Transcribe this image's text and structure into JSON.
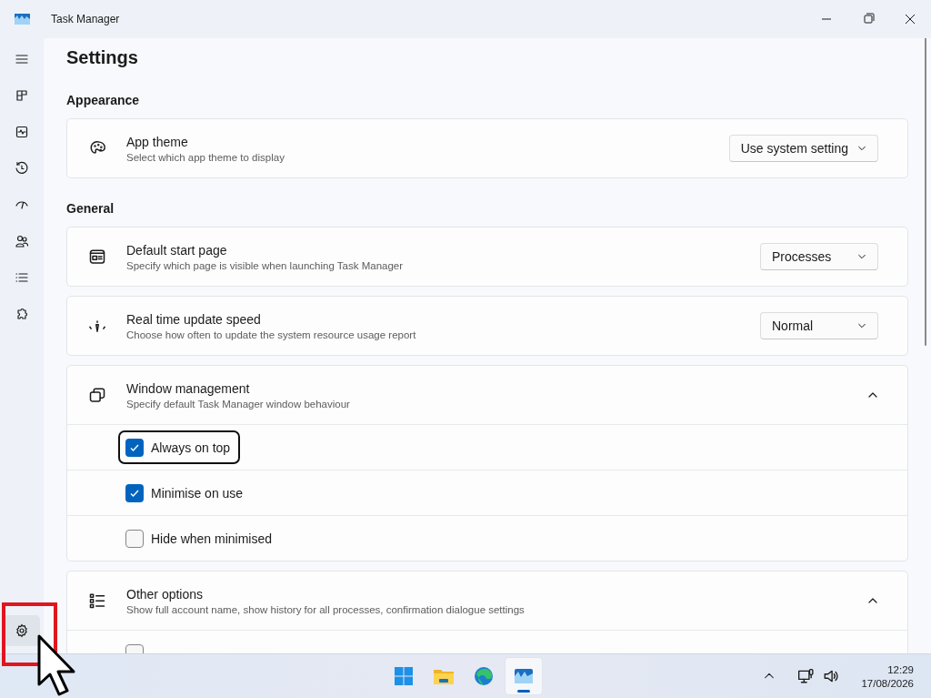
{
  "window": {
    "title": "Task Manager"
  },
  "sidebar": {
    "items": [
      {
        "selected": false
      },
      {
        "selected": false
      },
      {
        "selected": false
      },
      {
        "selected": false
      },
      {
        "selected": false
      },
      {
        "selected": false
      },
      {
        "selected": false
      },
      {
        "selected": false
      }
    ],
    "footer_item": {
      "selected": true
    }
  },
  "page": {
    "title": "Settings"
  },
  "sections": [
    {
      "heading": "Appearance",
      "cards": [
        {
          "kind": "dropdown",
          "title": "App theme",
          "description": "Select which app theme to display",
          "value": "Use system setting"
        }
      ]
    },
    {
      "heading": "General",
      "cards": [
        {
          "kind": "dropdown",
          "title": "Default start page",
          "description": "Specify which page is visible when launching Task Manager",
          "value": "Processes"
        },
        {
          "kind": "dropdown",
          "title": "Real time update speed",
          "description": "Choose how often to update the system resource usage report",
          "value": "Normal"
        },
        {
          "kind": "expander",
          "title": "Window management",
          "description": "Specify default Task Manager window behaviour",
          "expanded": true,
          "options": [
            {
              "label": "Always on top",
              "checked": true,
              "focused": true
            },
            {
              "label": "Minimise on use",
              "checked": true,
              "focused": false
            },
            {
              "label": "Hide when minimised",
              "checked": false,
              "focused": false
            }
          ]
        },
        {
          "kind": "expander",
          "title": "Other options",
          "description": "Show full account name, show history for all processes, confirmation dialogue settings",
          "expanded": true,
          "options": [
            {
              "checked": false,
              "focused": false
            }
          ]
        }
      ]
    }
  ],
  "taskbar": {
    "apps": [
      {
        "selected": false
      },
      {
        "selected": false
      },
      {
        "selected": false
      },
      {
        "selected": true
      }
    ],
    "clock": {
      "time": "12:29",
      "date": "17/08/2026"
    }
  }
}
